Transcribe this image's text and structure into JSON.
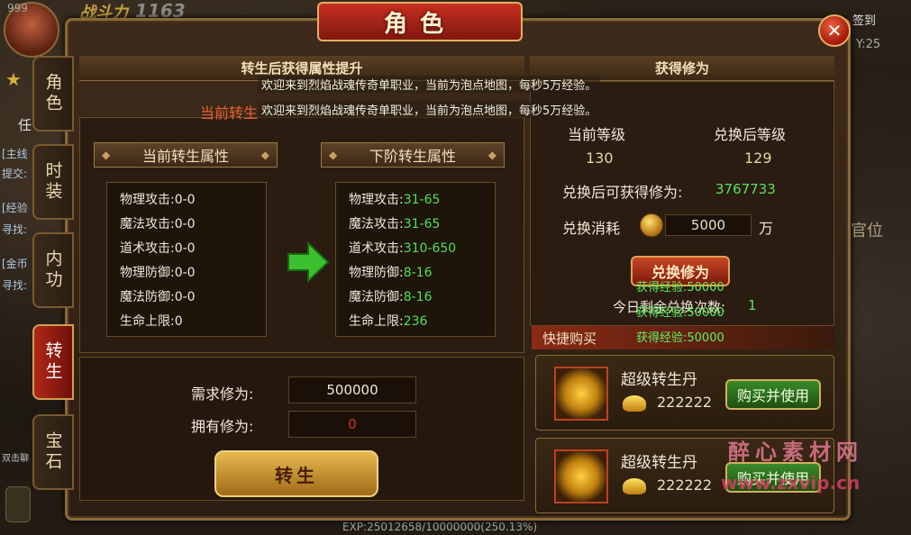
{
  "background": {
    "level": "999",
    "power_label": "战斗力",
    "power_value": "1163",
    "coord": "Y:25",
    "right_top": "签到",
    "right_side": "官位",
    "left_lines": [
      "[主线",
      "提交:",
      "[经验",
      "寻找:",
      "[金币",
      "寻找:"
    ],
    "left_side_char": "任",
    "dual_strike": "双击聊",
    "exp_bar": "EXP:25012658/10000000(250.13%)"
  },
  "window": {
    "title": "角色",
    "close_icon": "✕"
  },
  "tabs": [
    {
      "label": "角色",
      "active": false
    },
    {
      "label": "时装",
      "active": false
    },
    {
      "label": "内功",
      "active": false
    },
    {
      "label": "转生",
      "active": true
    },
    {
      "label": "宝石",
      "active": false
    }
  ],
  "left": {
    "heading": "转生后获得属性提升",
    "current_zs_label": "当前转生",
    "current_header": "当前转生属性",
    "next_header": "下阶转生属性",
    "current_attrs": [
      {
        "label": "物理攻击:",
        "value": "0-0"
      },
      {
        "label": "魔法攻击:",
        "value": "0-0"
      },
      {
        "label": "道术攻击:",
        "value": "0-0"
      },
      {
        "label": "物理防御:",
        "value": "0-0"
      },
      {
        "label": "魔法防御:",
        "value": "0-0"
      },
      {
        "label": "生命上限:",
        "value": "0"
      }
    ],
    "next_attrs": [
      {
        "label": "物理攻击:",
        "value": "31-65"
      },
      {
        "label": "魔法攻击:",
        "value": "31-65"
      },
      {
        "label": "道术攻击:",
        "value": "310-650"
      },
      {
        "label": "物理防御:",
        "value": "8-16"
      },
      {
        "label": "魔法防御:",
        "value": "8-16"
      },
      {
        "label": "生命上限:",
        "value": "236"
      }
    ],
    "need_label": "需求修为:",
    "need_value": "500000",
    "own_label": "拥有修为:",
    "own_value": "0",
    "button": "转生"
  },
  "right": {
    "heading": "获得修为",
    "cur_level_label": "当前等级",
    "cur_level_value": "130",
    "after_level_label": "兑换后等级",
    "after_level_value": "129",
    "gain_label": "兑换后可获得修为:",
    "gain_value": "3767733",
    "cost_label": "兑换消耗",
    "cost_value": "5000",
    "cost_unit": "万",
    "exchange_button": "兑换修为",
    "today_label": "今日剩余兑换次数:",
    "today_value": "1",
    "quick_buy": "快捷购买",
    "shop_items": [
      {
        "name": "超级转生丹",
        "price": "222222",
        "button": "购买并使用"
      },
      {
        "name": "超级转生丹",
        "price": "222222",
        "button": "购买并使用"
      }
    ]
  },
  "overlay": {
    "messages": [
      "欢迎来到烈焰战魂传奇单职业，当前为泡点地图，每秒5万经验。",
      "欢迎来到烈焰战魂传奇单职业，当前为泡点地图，每秒5万经验。"
    ],
    "exp_gain": [
      "获得经验:50000",
      "获得经验:50000",
      "获得经验:50000"
    ]
  },
  "watermark": {
    "line1": "醉心素材网",
    "line2": "www.zxvip.cn"
  }
}
